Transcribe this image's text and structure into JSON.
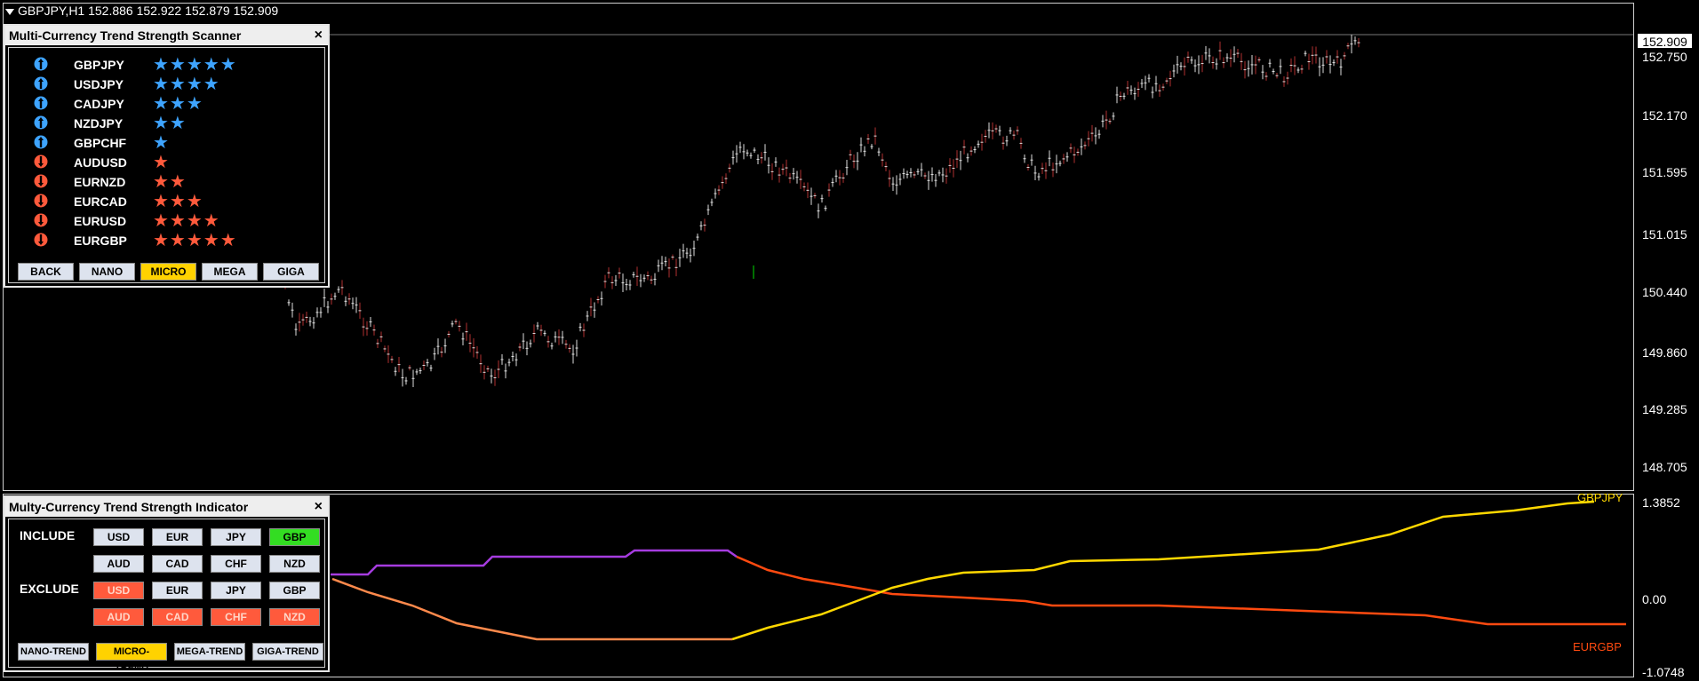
{
  "chart": {
    "symbol_header": "GBPJPY,H1  152.886 152.922 152.879 152.909",
    "current_price": "152.909",
    "price_labels": [
      "152.750",
      "152.170",
      "151.595",
      "151.015",
      "150.440",
      "149.860",
      "149.285",
      "148.705"
    ],
    "indicator_labels": {
      "top": "1.3852",
      "mid": "0.00",
      "bottom": "-1.0748"
    },
    "series_tags": {
      "top": "GBPJPY",
      "bottom": "EURGBP"
    },
    "colors": {
      "purple": "#a63ce0",
      "orange": "#ff8a4c",
      "yellow": "#ffd800",
      "red": "#ff4a10",
      "candle": "#b03030"
    }
  },
  "scanner": {
    "title": "Multi-Currency Trend Strength Scanner",
    "close": "×",
    "rows": [
      {
        "symbol": "GBPJPY",
        "dir": "up",
        "stars": "★★★★★"
      },
      {
        "symbol": "USDJPY",
        "dir": "up",
        "stars": "★★★★"
      },
      {
        "symbol": "CADJPY",
        "dir": "up",
        "stars": "★★★"
      },
      {
        "symbol": "NZDJPY",
        "dir": "up",
        "stars": "★★"
      },
      {
        "symbol": "GBPCHF",
        "dir": "up",
        "stars": "★"
      },
      {
        "symbol": "AUDUSD",
        "dir": "down",
        "stars": "★"
      },
      {
        "symbol": "EURNZD",
        "dir": "down",
        "stars": "★★"
      },
      {
        "symbol": "EURCAD",
        "dir": "down",
        "stars": "★★★"
      },
      {
        "symbol": "EURUSD",
        "dir": "down",
        "stars": "★★★★"
      },
      {
        "symbol": "EURGBP",
        "dir": "down",
        "stars": "★★★★★"
      }
    ],
    "buttons": [
      "BACK",
      "NANO",
      "MICRO",
      "MEGA",
      "GIGA"
    ],
    "active_button": "MICRO"
  },
  "indicator": {
    "title": "Multy-Currency Trend Strength Indicator",
    "close": "×",
    "include_label": "INCLUDE",
    "exclude_label": "EXCLUDE",
    "include": [
      "USD",
      "EUR",
      "JPY",
      "GBP",
      "AUD",
      "CAD",
      "CHF",
      "NZD"
    ],
    "include_active": "GBP",
    "exclude": [
      "USD",
      "EUR",
      "JPY",
      "GBP",
      "AUD",
      "CAD",
      "CHF",
      "NZD"
    ],
    "exclude_active": [
      "USD",
      "AUD",
      "CAD",
      "CHF",
      "NZD"
    ],
    "trend_buttons": [
      "NANO-TREND",
      "MICRO-TREND",
      "MEGA-TREND",
      "GIGA-TREND"
    ],
    "active_trend": "MICRO-TREND"
  }
}
